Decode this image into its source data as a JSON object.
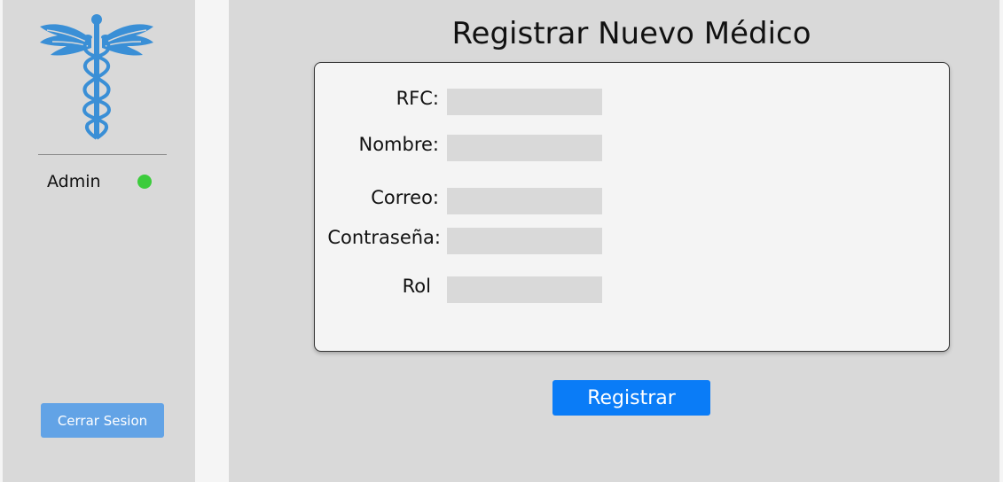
{
  "sidebar": {
    "logo_icon": "caduceus-icon",
    "logo_color": "#3a8fd6",
    "user": {
      "name": "Admin",
      "status_color": "#3ccc3c"
    },
    "logout_label": "Cerrar Sesion"
  },
  "main": {
    "title": "Registrar Nuevo Médico",
    "form": {
      "fields": [
        {
          "label": "RFC:",
          "value": ""
        },
        {
          "label": "Nombre:",
          "value": ""
        },
        {
          "label": "Correo:",
          "value": ""
        },
        {
          "label": "Contraseña:",
          "value": ""
        },
        {
          "label": "Rol",
          "value": ""
        }
      ],
      "submit_label": "Registrar"
    }
  }
}
